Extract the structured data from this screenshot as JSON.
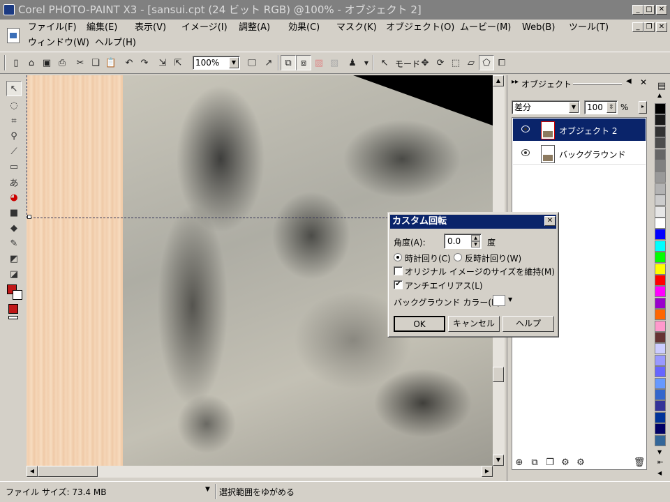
{
  "window": {
    "title": "Corel PHOTO-PAINT X3 - [sansui.cpt (24 ビット RGB) @100% - オブジェクト 2]"
  },
  "menu": [
    "ファイル(F)",
    "編集(E)",
    "表示(V)",
    "イメージ(I)",
    "調整(A)",
    "効果(C)",
    "マスク(K)",
    "オブジェクト(O)",
    "ムービー(M)",
    "Web(B)",
    "ツール(T)",
    "ウィンドウ(W)",
    "ヘルプ(H)"
  ],
  "toolbar": {
    "zoom": "100%",
    "mode_label": "モード"
  },
  "docker": {
    "title": "オブジェクト",
    "merge_mode": "差分",
    "opacity": "100",
    "opacity_unit": "%",
    "layers": [
      {
        "name": "オブジェクト 2",
        "selected": true
      },
      {
        "name": "バックグラウンド",
        "selected": false
      }
    ]
  },
  "dialog": {
    "title": "カスタム回転",
    "angle_label": "角度(A):",
    "angle_value": "0.0",
    "angle_unit": "度",
    "clockwise": "時計回り(C)",
    "counterclockwise": "反時計回り(W)",
    "keep_size": "オリジナル イメージのサイズを維持(M)",
    "antialias": "アンチエイリアス(L)",
    "bg_color_label": "バックグラウンド カラー(B):",
    "ok": "OK",
    "cancel": "キャンセル",
    "help": "ヘルプ",
    "state": {
      "clockwise_selected": true,
      "keep_size_checked": false,
      "antialias_checked": true
    }
  },
  "status": {
    "file_size": "ファイル サイズ: 73.4 MB",
    "hint": "選択範囲をゆがめる"
  },
  "colors": {
    "foreground": "#c01818",
    "background": "#ffffff",
    "palette": [
      "#000000",
      "#1a1a1a",
      "#333333",
      "#4d4d4d",
      "#666666",
      "#808080",
      "#999999",
      "#b3b3b3",
      "#cccccc",
      "#e6e6e6",
      "#ffffff",
      "#0000ff",
      "#00ffff",
      "#00ff00",
      "#ffff00",
      "#ff0000",
      "#ff00ff",
      "#9900cc",
      "#ff6600",
      "#ff99cc",
      "#663333",
      "#ccccff",
      "#9999ff",
      "#6666ff",
      "#6699ff",
      "#3366cc",
      "#333399",
      "#003399",
      "#000066",
      "#336699"
    ]
  }
}
